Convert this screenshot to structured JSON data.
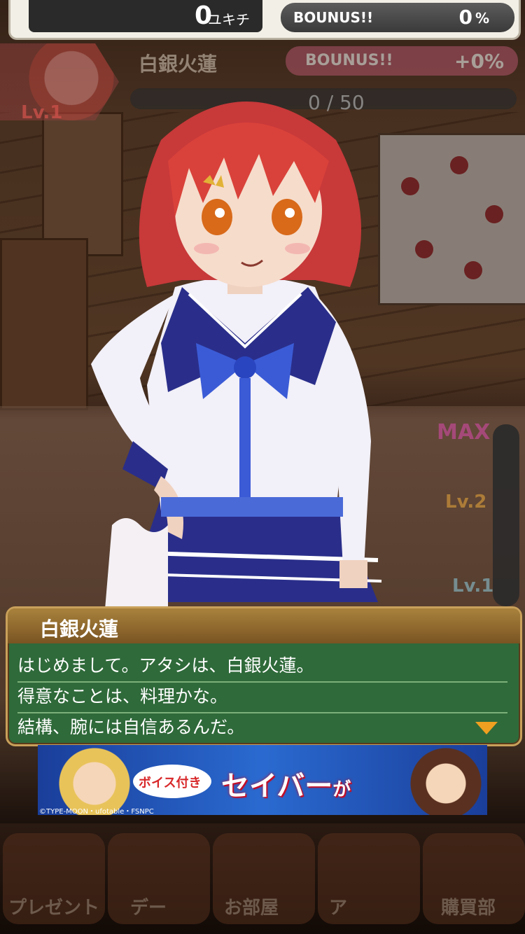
{
  "header": {
    "currency_value": "0",
    "currency_unit": "ユキチ",
    "bonus_label": "BOUNUS!!",
    "bonus_value": "0",
    "bonus_unit": "%"
  },
  "character": {
    "name": "白銀火蓮",
    "level": "Lv.1",
    "bonus_label": "BOUNUS!!",
    "bonus_value": "+0%",
    "exp_current": 0,
    "exp_text": "0 / 50",
    "exp_fraction": 0.0
  },
  "gauge": {
    "max_label": "MAX",
    "lv2_label": "Lv.2",
    "lv1_label": "Lv.1",
    "fill_fraction": 0.0
  },
  "dialog": {
    "speaker": "白銀火蓮",
    "lines": [
      "はじめまして。アタシは、白銀火蓮。",
      "得意なことは、料理かな。",
      "結構、腕には自信あるんだ。"
    ]
  },
  "banner": {
    "bubble_text": "ボイス付き",
    "main_text": "セイバー",
    "main_suffix": "が",
    "copyright": "©TYPE-MOON・ufotable・FSNPC"
  },
  "nav": {
    "items": [
      {
        "label": "プレゼント"
      },
      {
        "label": "デー"
      },
      {
        "label": "お部屋"
      },
      {
        "label": "ア"
      },
      {
        "label": "購買部"
      }
    ]
  },
  "colors": {
    "dialog_bg": "#2f6a3a",
    "dialog_border": "#c9a05a",
    "advance_arrow": "#f0a020",
    "hair": "#d9423a"
  }
}
